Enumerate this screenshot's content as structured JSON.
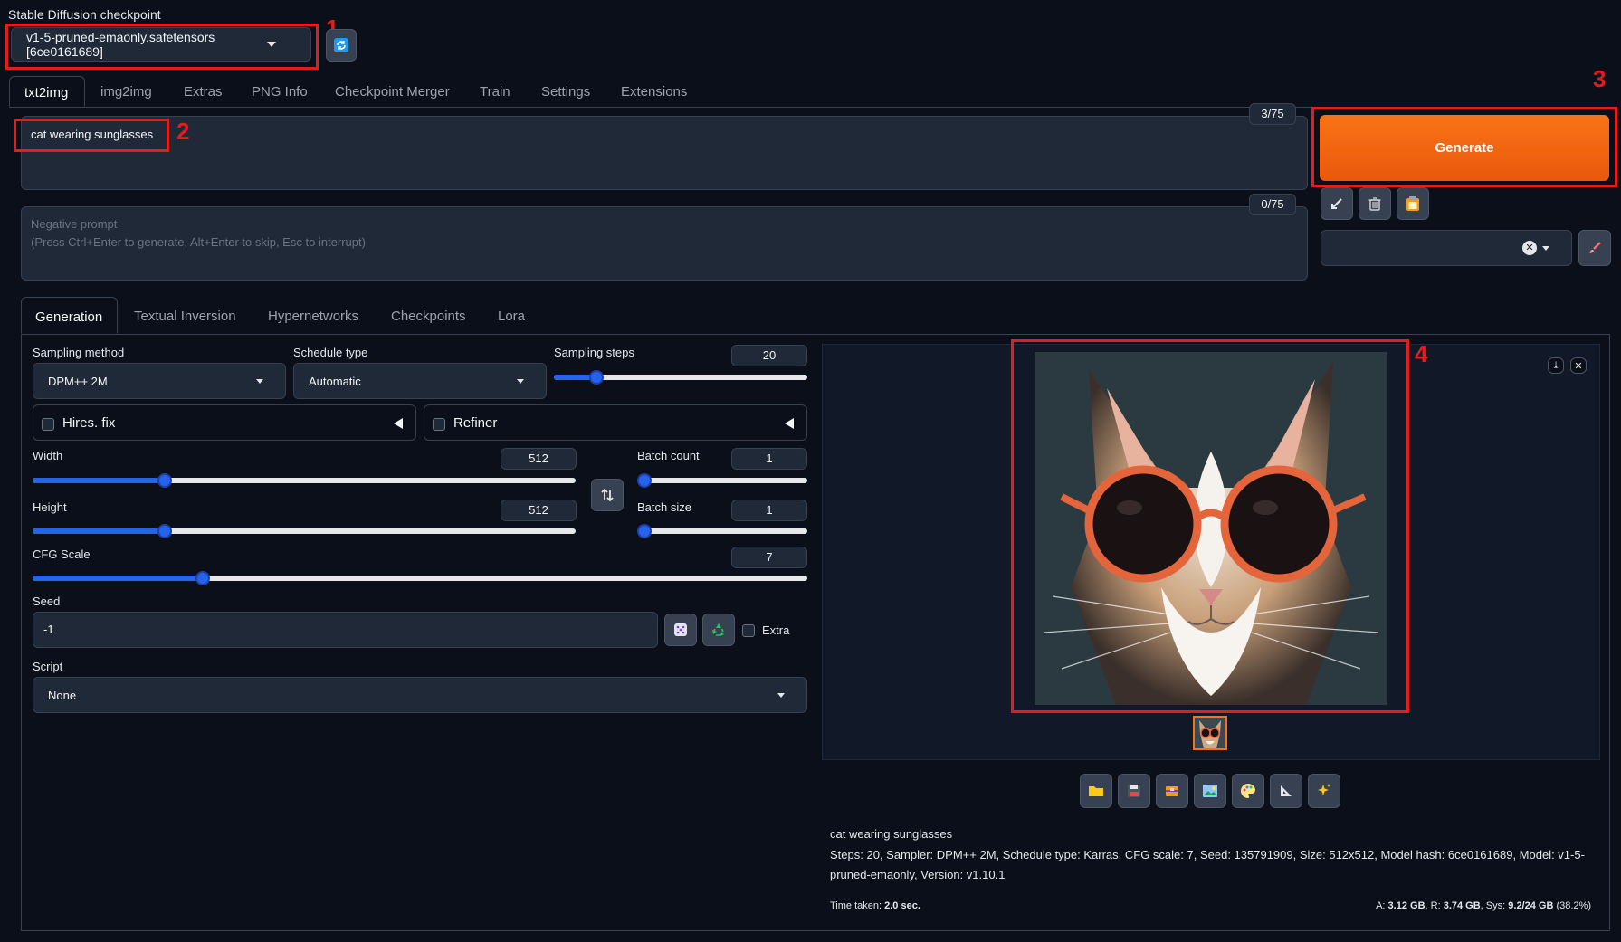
{
  "checkpoint": {
    "label": "Stable Diffusion checkpoint",
    "value": "v1-5-pruned-emaonly.safetensors [6ce0161689]"
  },
  "main_tabs": [
    "txt2img",
    "img2img",
    "Extras",
    "PNG Info",
    "Checkpoint Merger",
    "Train",
    "Settings",
    "Extensions"
  ],
  "prompt": {
    "value": "cat wearing sunglasses",
    "token_count": "3/75"
  },
  "negative_prompt": {
    "placeholder_line1": "Negative prompt",
    "placeholder_line2": "(Press Ctrl+Enter to generate, Alt+Enter to skip, Esc to interrupt)",
    "token_count": "0/75"
  },
  "generate_label": "Generate",
  "sub_tabs": [
    "Generation",
    "Textual Inversion",
    "Hypernetworks",
    "Checkpoints",
    "Lora"
  ],
  "generation": {
    "sampling_method_label": "Sampling method",
    "sampling_method": "DPM++ 2M",
    "schedule_type_label": "Schedule type",
    "schedule_type": "Automatic",
    "sampling_steps_label": "Sampling steps",
    "sampling_steps": "20",
    "hires_label": "Hires. fix",
    "refiner_label": "Refiner",
    "width_label": "Width",
    "width": "512",
    "height_label": "Height",
    "height": "512",
    "batch_count_label": "Batch count",
    "batch_count": "1",
    "batch_size_label": "Batch size",
    "batch_size": "1",
    "cfg_label": "CFG Scale",
    "cfg": "7",
    "seed_label": "Seed",
    "seed": "-1",
    "extra_label": "Extra",
    "script_label": "Script",
    "script": "None"
  },
  "slider_levels": {
    "sampling_steps": 0.14,
    "width": 0.23,
    "height": 0.23,
    "batch_count": 0.0,
    "batch_size": 0.0,
    "cfg": 0.21
  },
  "output": {
    "prompt": "cat wearing sunglasses",
    "params_line1": "Steps: 20, Sampler: DPM++ 2M, Schedule type: Karras, CFG scale: 7, Seed: 135791909, Size: 512x512, Model hash: 6ce0161689, Model: v1-5-",
    "params_line2": "pruned-emaonly, Version: v1.10.1",
    "time_label": "Time taken:",
    "time_value": "2.0 sec.",
    "mem_a_label": "A:",
    "mem_a": "3.12 GB",
    "mem_r_label": "R:",
    "mem_r": "3.74 GB",
    "mem_sys_label": "Sys:",
    "mem_sys": "9.2/24 GB",
    "mem_pct": "(38.2%)"
  },
  "annotations": [
    "1",
    "2",
    "3",
    "4"
  ],
  "colors": {
    "accent_orange": "#f97316",
    "slider_blue": "#2563eb",
    "annotation_red": "#e11d1d",
    "background": "#0b0f19"
  }
}
